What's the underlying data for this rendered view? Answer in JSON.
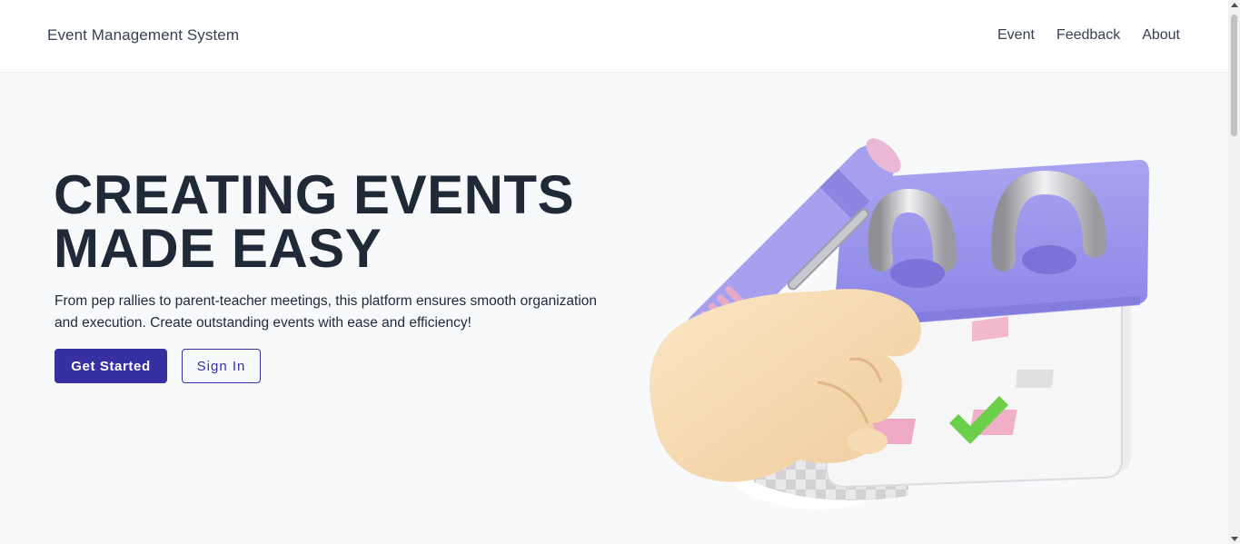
{
  "header": {
    "brand": "Event Management System",
    "nav": [
      {
        "label": "Event"
      },
      {
        "label": "Feedback"
      },
      {
        "label": "About"
      }
    ]
  },
  "hero": {
    "title_line1": "CREATING EVENTS",
    "title_line2": "MADE EASY",
    "description": "From pep rallies to parent-teacher meetings, this platform ensures smooth organization and execution. Create outstanding events with ease and efficiency!",
    "primary_button": "Get Started",
    "secondary_button": "Sign In"
  },
  "illustration": {
    "icon": "calendar-pen-hand-icon"
  },
  "colors": {
    "accent": "#3730a3",
    "background": "#f8f9fb",
    "navbar_bg": "#ffffff",
    "text": "#1f2937"
  }
}
